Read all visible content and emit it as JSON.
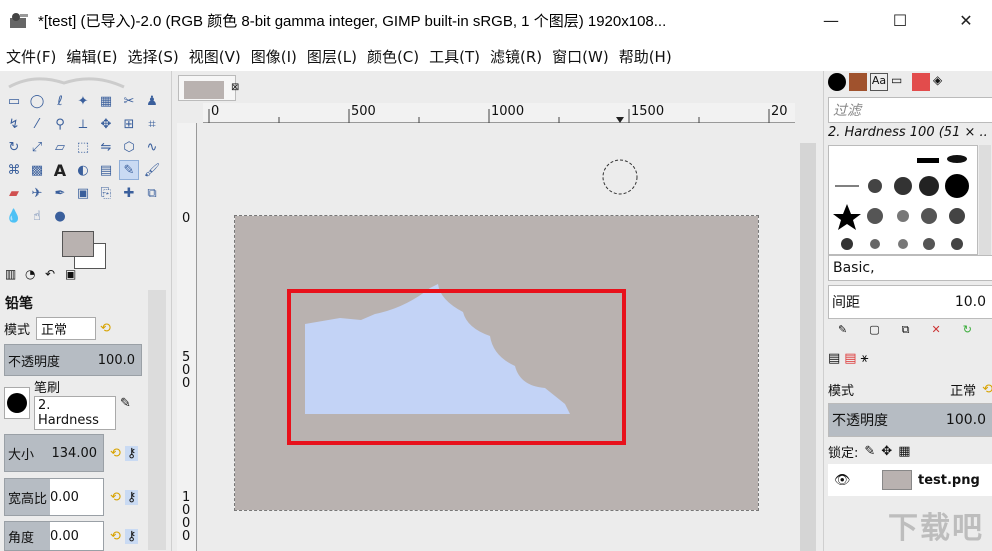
{
  "window": {
    "title": "*[test] (已导入)-2.0 (RGB 颜色 8-bit gamma integer, GIMP built-in sRGB, 1 个图层) 1920x108...",
    "minimize": "—",
    "maximize": "☐",
    "close": "✕"
  },
  "menu": [
    "文件(F)",
    "编辑(E)",
    "选择(S)",
    "视图(V)",
    "图像(I)",
    "图层(L)",
    "颜色(C)",
    "工具(T)",
    "滤镜(R)",
    "窗口(W)",
    "帮助(H)"
  ],
  "toolbox": {
    "tool_options_title": "铅笔",
    "mode_label": "模式",
    "mode_value": "正常",
    "opacity_label": "不透明度",
    "opacity_value": "100.0",
    "brush_label": "笔刷",
    "brush_value": "2. Hardness",
    "size_label": "大小",
    "size_value": "134.00",
    "aspect_label": "宽高比",
    "aspect_value": "0.00",
    "angle_label": "角度",
    "angle_value": "0.00"
  },
  "ruler": {
    "h_labels": [
      "0",
      "500",
      "1000",
      "1500",
      "20"
    ],
    "v_labels": [
      "0",
      "5\n0\n0",
      "1\n0\n0\n0"
    ]
  },
  "right": {
    "filter_placeholder": "过滤",
    "brush_name": "2. Hardness 100 (51 × ...",
    "preset": "Basic,",
    "spacing_label": "间距",
    "spacing_value": "10.0",
    "mode_label": "模式",
    "mode_value": "正常",
    "opacity_label": "不透明度",
    "opacity_value": "100.0",
    "lock_label": "锁定:",
    "layer_name": "test.png"
  },
  "colors": {
    "fg": "#b9b2b0",
    "image_bg": "#b9b2b0",
    "sky": "#c3d3f6",
    "highlight_box": "#e8111b"
  }
}
